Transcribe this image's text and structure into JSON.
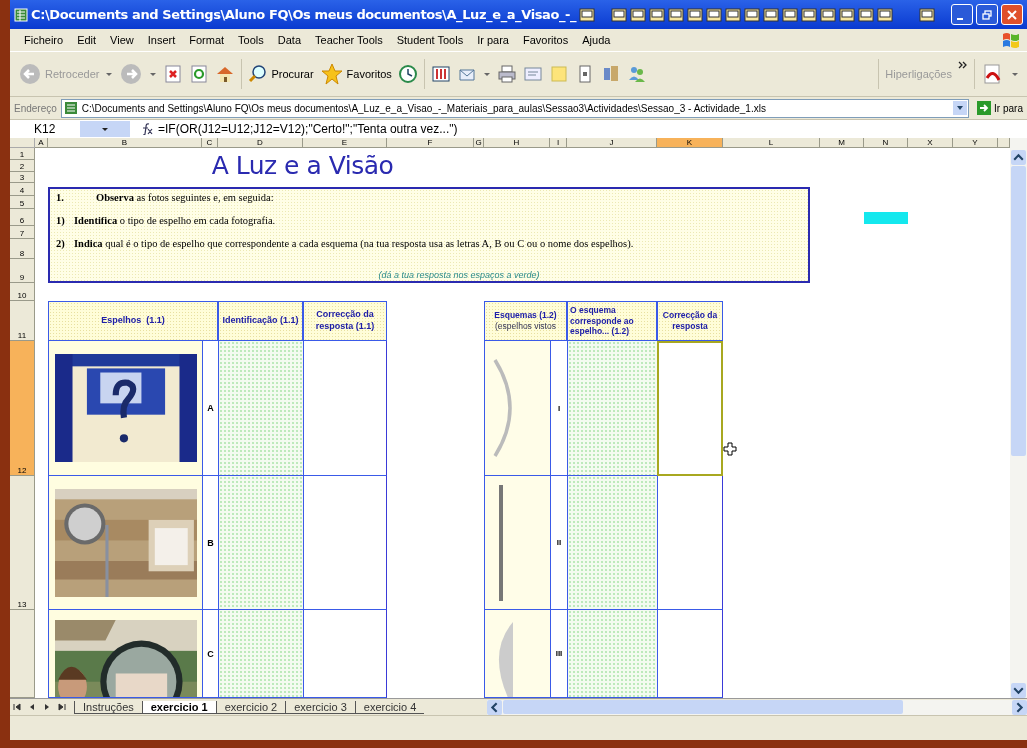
{
  "window": {
    "title": "C:\\Documents and Settings\\Aluno FQ\\Os meus documentos\\A_Luz_e_a_Visao_-_"
  },
  "menu": [
    "Ficheiro",
    "Edit",
    "View",
    "Insert",
    "Format",
    "Tools",
    "Data",
    "Teacher Tools",
    "Student Tools",
    "Ir para",
    "Favoritos",
    "Ajuda"
  ],
  "toolbar": {
    "back_label": "Retroceder",
    "search_label": "Procurar",
    "favorites_label": "Favoritos",
    "links_label": "Hiperligações"
  },
  "address": {
    "label": "Endereço",
    "value": "C:\\Documents and Settings\\Aluno FQ\\Os meus documentos\\A_Luz_e_a_Visao_-_Materiais_para_aulas\\Sessao3\\Actividades\\Sessao_3 - Actividade_1.xls",
    "go_label": "Ir para"
  },
  "formula_bar": {
    "cell": "K12",
    "formula": "=IF(OR(J12=U12;J12=V12);\"Certo!\";\"Tenta outra vez...\")"
  },
  "columns": [
    {
      "label": "A",
      "selected": false
    },
    {
      "label": "B",
      "selected": false
    },
    {
      "label": "C",
      "selected": false
    },
    {
      "label": "D",
      "selected": false
    },
    {
      "label": "E",
      "selected": false
    },
    {
      "label": "F",
      "selected": false
    },
    {
      "label": "G",
      "selected": false
    },
    {
      "label": "H",
      "selected": false
    },
    {
      "label": "I",
      "selected": false
    },
    {
      "label": "J",
      "selected": false
    },
    {
      "label": "K",
      "selected": true
    },
    {
      "label": "L",
      "selected": false
    },
    {
      "label": "M",
      "selected": false
    },
    {
      "label": "N",
      "selected": false
    },
    {
      "label": "X",
      "selected": false
    },
    {
      "label": "Y",
      "selected": false
    }
  ],
  "rows": [
    {
      "label": "1",
      "selected": false
    },
    {
      "label": "2",
      "selected": false
    },
    {
      "label": "3",
      "selected": false
    },
    {
      "label": "4",
      "selected": false
    },
    {
      "label": "5",
      "selected": false
    },
    {
      "label": "6",
      "selected": false
    },
    {
      "label": "7",
      "selected": false
    },
    {
      "label": "8",
      "selected": false
    },
    {
      "label": "9",
      "selected": false
    },
    {
      "label": "10",
      "selected": false
    },
    {
      "label": "11",
      "selected": false
    },
    {
      "label": "12",
      "selected": true
    },
    {
      "label": "13",
      "selected": false
    }
  ],
  "sheet_title": "A Luz e a Visão",
  "instructions": [
    {
      "number": "1.",
      "text": "**Observa** as fotos seguintes e, em seguida:"
    },
    {
      "number": "1)",
      "text": "**Identifica** o tipo de espelho em cada fotografia."
    },
    {
      "number": "2)",
      "text": "**Indica** qual é o tipo de espelho que correspondente a cada esquema (na tua resposta usa as letras A, B ou C ou o nome dos espelhos)."
    }
  ],
  "instructions_note": "(dá a tua resposta nos espaços a verde)",
  "mirrors_table": {
    "headers": [
      "Espelhos  (1.1)",
      "Identificação (1.1)",
      "Correcção da resposta (1.1)"
    ],
    "rows": [
      {
        "letter": "A"
      },
      {
        "letter": "B"
      },
      {
        "letter": "C"
      }
    ]
  },
  "schemes_table": {
    "headers": [
      "Esquemas (1.2)",
      "O esquema corresponde ao espelho... (1.2)",
      "Correcção da resposta"
    ],
    "header_note": "(espelhos vistos",
    "rows": [
      {
        "numeral": "I",
        "kind": "curved",
        "selected": true
      },
      {
        "numeral": "II",
        "kind": "flat",
        "selected": false
      },
      {
        "numeral": "III",
        "kind": "half-disc",
        "selected": false
      }
    ]
  },
  "sheet_tabs": [
    {
      "label": "Instruções",
      "selected": false
    },
    {
      "label": "exercicio 1",
      "selected": true
    },
    {
      "label": "exercicio 2",
      "selected": false
    },
    {
      "label": "exercicio 3",
      "selected": false
    },
    {
      "label": "exercicio 4",
      "selected": false
    }
  ]
}
